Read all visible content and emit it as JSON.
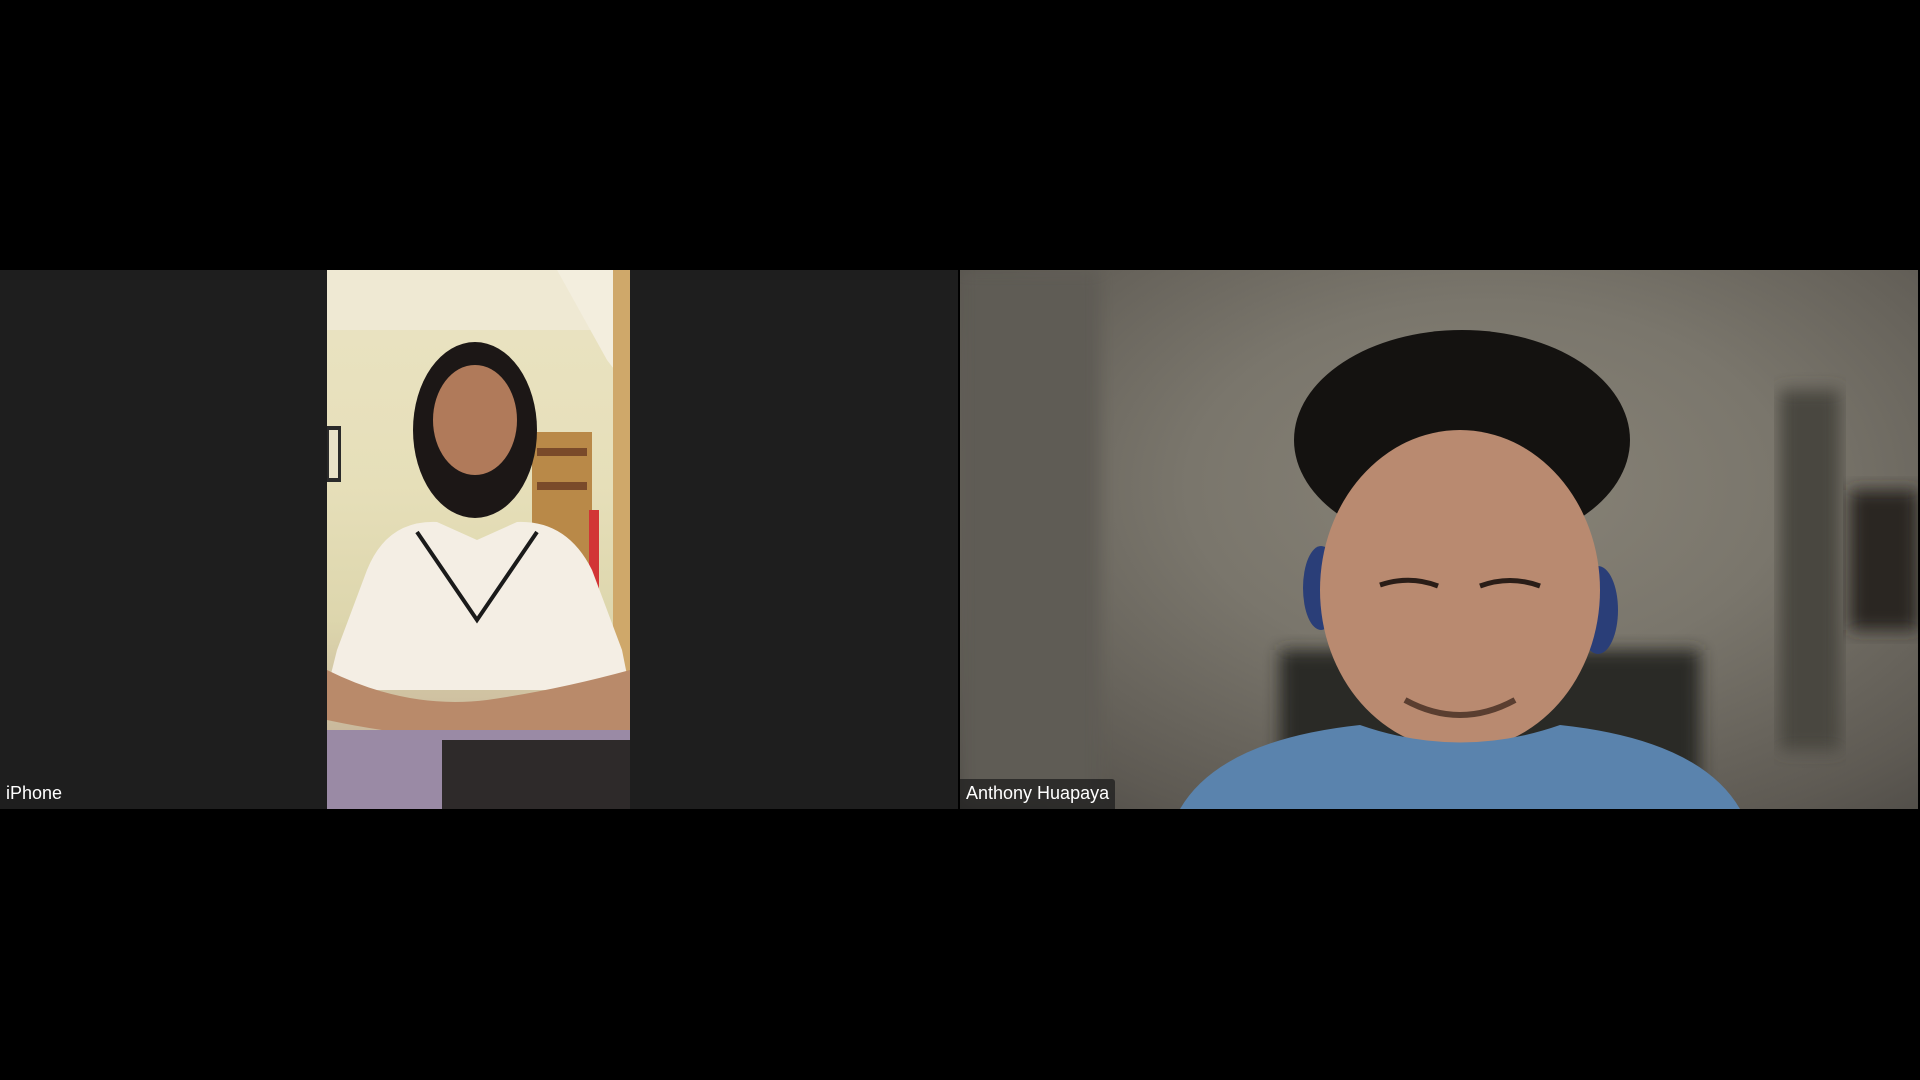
{
  "participants": [
    {
      "name": "iPhone"
    },
    {
      "name": "Anthony Huapaya"
    }
  ]
}
